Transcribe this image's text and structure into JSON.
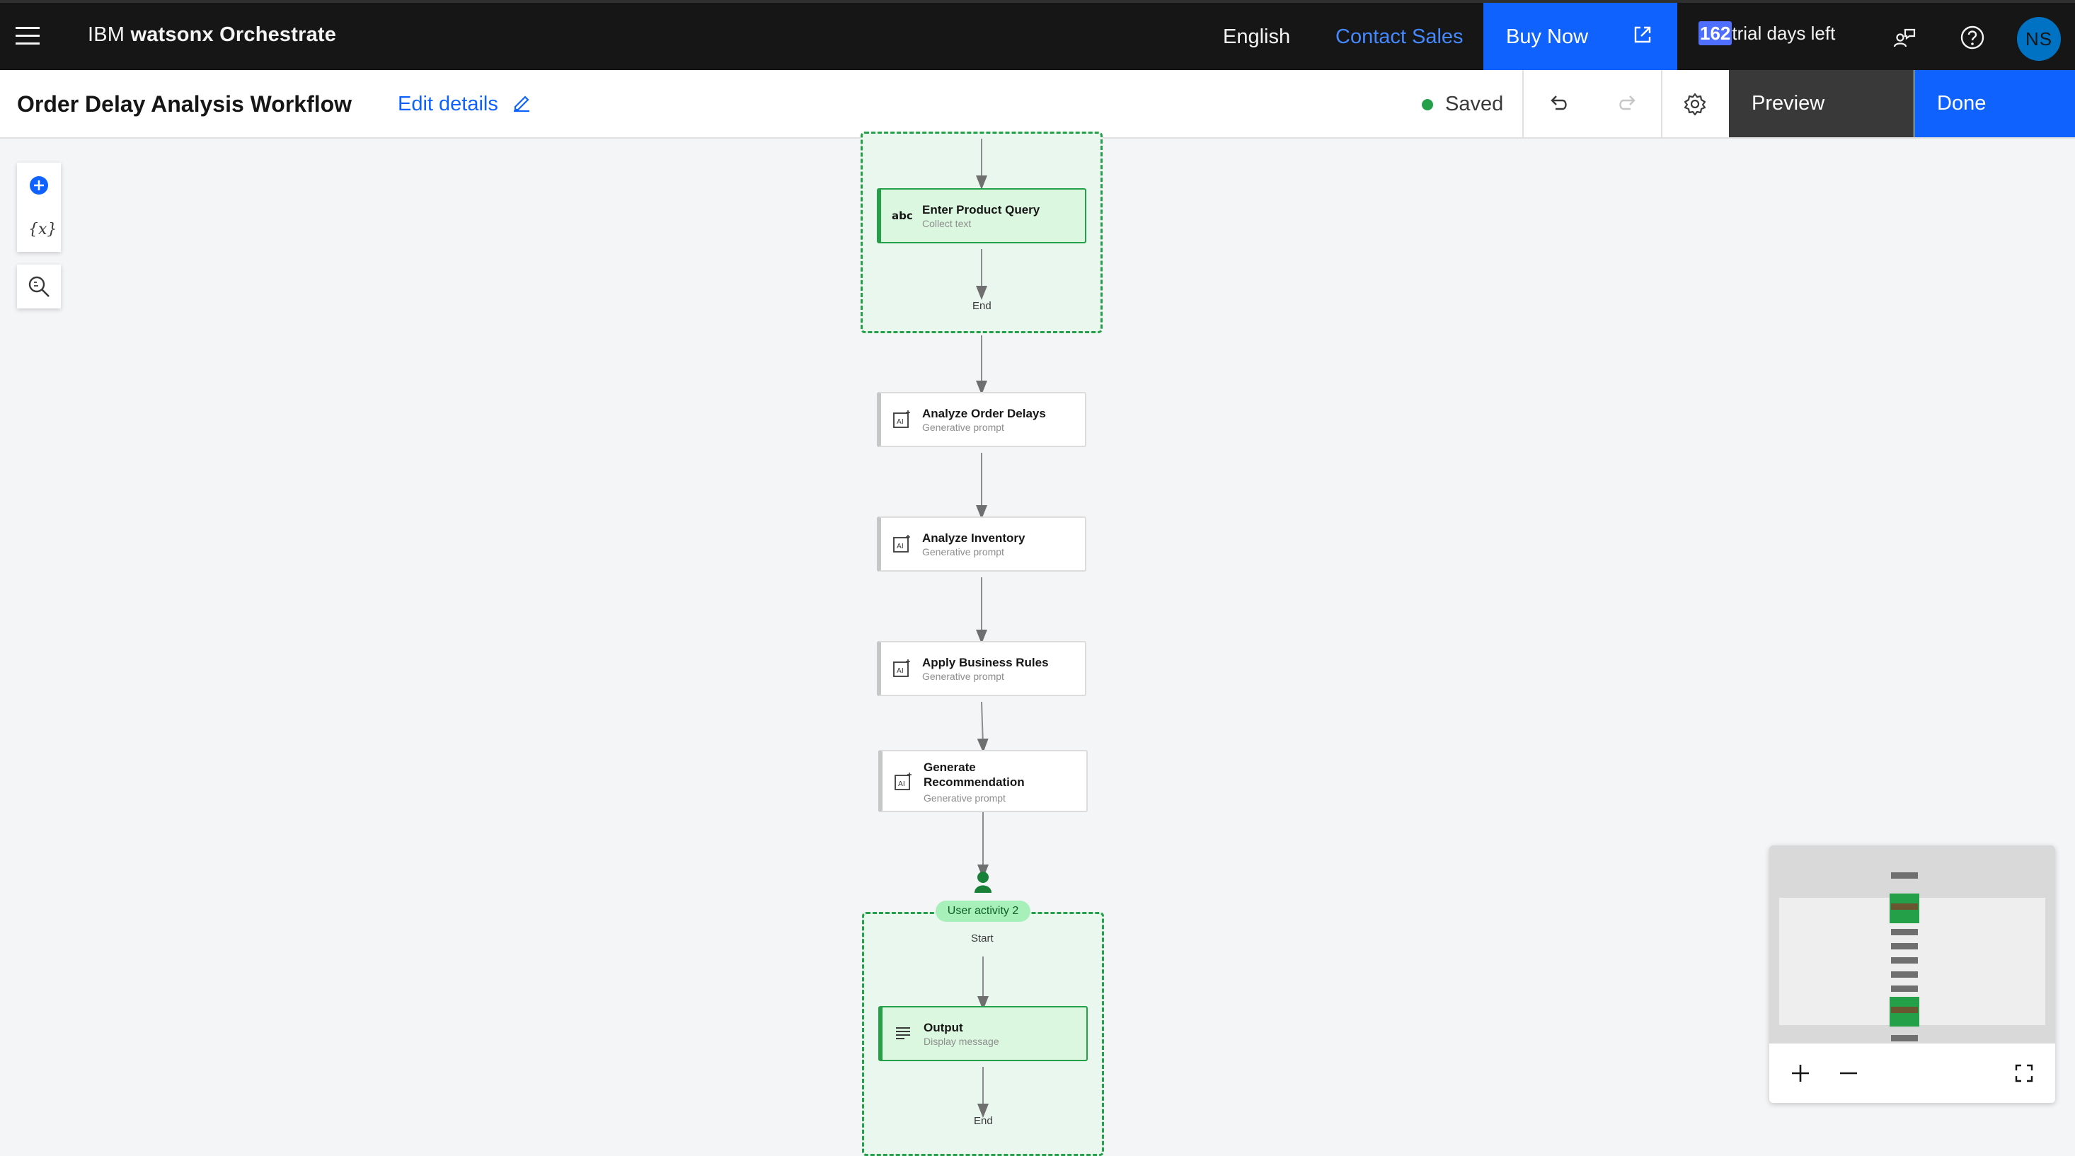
{
  "topbar": {
    "brand_prefix": "IBM",
    "brand_name": "watsonx Orchestrate",
    "language": "English",
    "contact_sales": "Contact Sales",
    "buy_now": "Buy Now",
    "trial_days": "162",
    "trial_text": "trial days left",
    "avatar_initials": "NS",
    "icons": [
      "menu-icon",
      "external-link-icon",
      "feedback-icon",
      "help-icon"
    ]
  },
  "header": {
    "title": "Order Delay Analysis Workflow",
    "edit_details": "Edit details",
    "status": "Saved",
    "preview": "Preview",
    "done": "Done",
    "icons": [
      "edit-icon",
      "undo-icon",
      "redo-icon",
      "settings-icon"
    ]
  },
  "palette": {
    "icons": [
      "add-icon",
      "variables-icon",
      "search-zoom-icon"
    ]
  },
  "flow": {
    "group1": {
      "node": {
        "title": "Enter Product Query",
        "subtitle": "Collect text",
        "icon": "abc-text-icon"
      },
      "end_label": "End"
    },
    "nodes": [
      {
        "title": "Analyze Order Delays",
        "subtitle": "Generative prompt",
        "icon": "ai-prompt-icon"
      },
      {
        "title": "Analyze Inventory",
        "subtitle": "Generative prompt",
        "icon": "ai-prompt-icon"
      },
      {
        "title": "Apply Business Rules",
        "subtitle": "Generative prompt",
        "icon": "ai-prompt-icon"
      },
      {
        "title": "Generate Recommendation",
        "subtitle": "Generative prompt",
        "icon": "ai-prompt-icon"
      }
    ],
    "group2": {
      "badge": "User activity 2",
      "start_label": "Start",
      "node": {
        "title": "Output",
        "subtitle": "Display message",
        "icon": "text-lines-icon"
      },
      "end_label": "End"
    }
  },
  "minimap": {
    "icons": [
      "zoom-in-icon",
      "zoom-out-icon",
      "fit-screen-icon"
    ]
  },
  "colors": {
    "topbar_bg": "#161616",
    "primary_blue": "#0f62fe",
    "success_green": "#24a148",
    "group_bg": "#eaf7ee",
    "canvas_bg": "#f4f5f7"
  }
}
